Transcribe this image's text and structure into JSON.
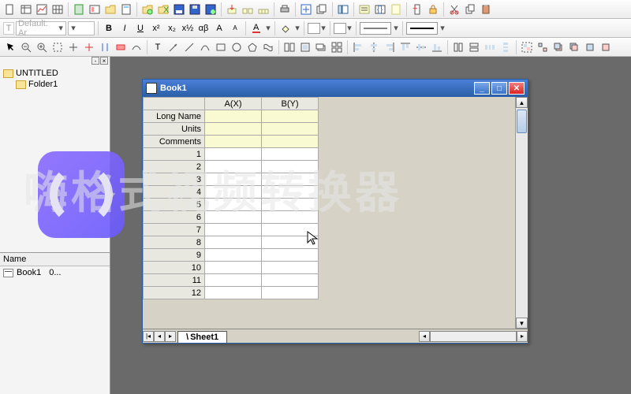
{
  "toolbars": {
    "row1_icons": [
      "new-doc",
      "new-sheet",
      "new-graph",
      "new-matrix",
      "new-excel",
      "new-layout",
      "open",
      "template",
      "save",
      "save-project",
      "save-all",
      "import",
      "import-wizard",
      "import-multi",
      "print",
      "print-preview",
      "recalc",
      "project",
      "results-log",
      "notes",
      "new-folder",
      "lock",
      "refresh",
      "cut",
      "copy",
      "paste"
    ],
    "row2_icons": [
      "bold",
      "italic",
      "underline",
      "superscript",
      "subscript",
      "sup2",
      "sub2",
      "greek",
      "increase-font",
      "decrease-font",
      "font-color",
      "fill-color",
      "line-color",
      "line-style",
      "line-width",
      "border-style"
    ],
    "row3_icons": [
      "pointer",
      "zoom-out",
      "zoom-in",
      "rescale",
      "reader",
      "region",
      "mask",
      "text",
      "line",
      "arrow",
      "curve",
      "rect",
      "circle",
      "poly",
      "freehand",
      "align-left",
      "align-center",
      "align-right",
      "align-top",
      "align-mid",
      "align-bottom",
      "distribute-h",
      "distribute-v",
      "group",
      "ungroup",
      "front",
      "back",
      "foreward",
      "backward",
      "grid",
      "snap"
    ],
    "font_label": "T",
    "font_name": "Default: Ar",
    "font_size": ""
  },
  "project": {
    "root": "UNTITLED",
    "folder": "Folder1",
    "list_header": "Name",
    "items": [
      {
        "name": "Book1",
        "extra": "0..."
      }
    ]
  },
  "window": {
    "title": "Book1",
    "columns": [
      "A(X)",
      "B(Y)"
    ],
    "meta_rows": [
      "Long Name",
      "Units",
      "Comments"
    ],
    "data_rows": [
      1,
      2,
      3,
      4,
      5,
      6,
      7,
      8,
      9,
      10,
      11,
      12
    ],
    "sheet_tab": "Sheet1"
  },
  "watermark": "嗨格式视频转换器"
}
